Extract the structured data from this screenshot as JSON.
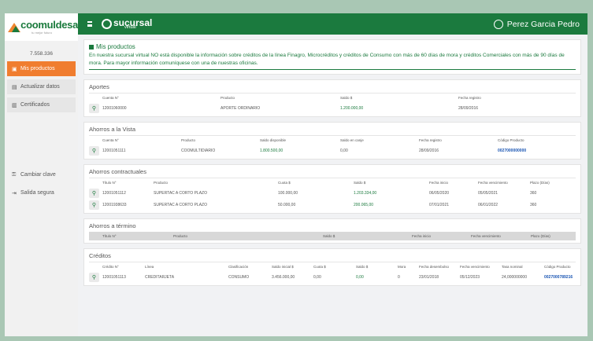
{
  "sidebar": {
    "brand": "coomuldesa",
    "tagline": "tu mejor futuro",
    "user_id": "7.558.336",
    "nav": [
      {
        "label": "Mis productos",
        "icon": "wallet-icon"
      },
      {
        "label": "Actualizar datos",
        "icon": "id-card-icon"
      },
      {
        "label": "Certificados",
        "icon": "document-icon"
      }
    ],
    "lower": [
      {
        "label": "Cambiar clave",
        "icon": "key-icon"
      },
      {
        "label": "Salida segura",
        "icon": "logout-icon"
      }
    ]
  },
  "header": {
    "logo_main": "sucursal",
    "logo_sub": "virtual",
    "user_name": "Perez Garcia Pedro"
  },
  "notice": {
    "title": "Mis productos",
    "text": "En nuestra sucursal virtual NO está disponible la información sobre créditos de la línea Finagro, Microcréditos y créditos de Consumo con más de 60 días de mora y créditos Comerciales con más de 90 días de mora. Para mayor información comuníquese con una de nuestras oficinas."
  },
  "aportes": {
    "title": "Aportes",
    "headers": [
      "Cuenta N°",
      "Producto",
      "Saldo $",
      "Fecha registro"
    ],
    "rows": [
      [
        "12001060000",
        "APORTE ORDINARIO",
        "1.200.000,00",
        "28/09/2016"
      ]
    ]
  },
  "vista": {
    "title": "Ahorros a la Vista",
    "headers": [
      "Cuenta N°",
      "Producto",
      "Saldo disponible",
      "Saldo en canje",
      "Fecha registro",
      "Código Producto"
    ],
    "rows": [
      [
        "12001051111",
        "COOMULTIDIARIO",
        "1.800.500,00",
        "0,00",
        "28/09/2016",
        "0027000000000"
      ]
    ]
  },
  "contractuales": {
    "title": "Ahorros contractuales",
    "headers": [
      "Título N°",
      "Producto",
      "Cuota $",
      "Saldo $",
      "Fecha inicio",
      "Fecha vencimiento",
      "Plazo (Días)"
    ],
    "rows": [
      [
        "12001051112",
        "SUPERTAC A CORTO PLAZO",
        "100.000,00",
        "1.203.334,00",
        "06/05/2020",
        "05/05/2021",
        "360"
      ],
      [
        "12001938633",
        "SUPERTAC A CORTO PLAZO",
        "50.000,00",
        "200.065,00",
        "07/01/2021",
        "06/01/2022",
        "360"
      ]
    ]
  },
  "termino": {
    "title": "Ahorros a término",
    "headers": [
      "Título N°",
      "Producto",
      "Saldo $",
      "Fecha inicio",
      "Fecha vencimiento",
      "Plazo (Días)"
    ]
  },
  "creditos": {
    "title": "Créditos",
    "headers": [
      "Crédito N°",
      "Línea",
      "Clasificación",
      "Saldo inicial $",
      "Cuota $",
      "Saldo $",
      "Mora",
      "Fecha desembolso",
      "Fecha vencimiento",
      "Tasa nominal",
      "Código Producto"
    ],
    "rows": [
      [
        "12001051113",
        "CREDITARJETA",
        "CONSUMO",
        "3.456.000,00",
        "0,00",
        "0,00",
        "0",
        "23/01/2018",
        "05/12/2023",
        "24,000000000",
        "0027000789216"
      ]
    ]
  }
}
